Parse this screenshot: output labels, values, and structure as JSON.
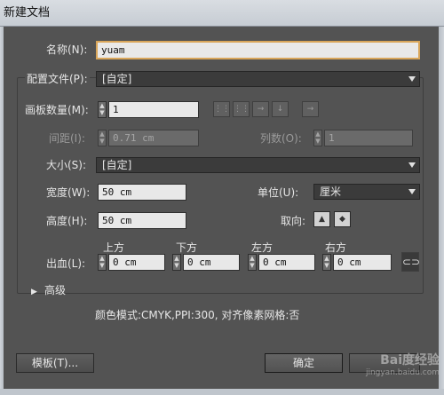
{
  "window": {
    "title": "新建文档"
  },
  "name": {
    "label": "名称(N):",
    "value": "yuam"
  },
  "profile": {
    "label": "配置文件(P):",
    "value": "[自定]"
  },
  "artboards": {
    "count_label": "画板数量(M):",
    "count_value": "1",
    "layout_icons": [
      "grid-by-row-icon",
      "grid-by-column-icon",
      "arrange-by-row-icon",
      "arrange-by-column-icon",
      "right-to-left-icon"
    ],
    "spacing_label": "间距(I):",
    "spacing_value": "0.71 cm",
    "columns_label": "列数(O):",
    "columns_value": "1"
  },
  "size": {
    "label": "大小(S):",
    "value": "[自定]"
  },
  "width": {
    "label": "宽度(W):",
    "value": "50 cm"
  },
  "units": {
    "label": "单位(U):",
    "value": "厘米"
  },
  "height": {
    "label": "高度(H):",
    "value": "50 cm"
  },
  "orientation": {
    "label": "取向:",
    "icons": [
      "portrait-icon",
      "landscape-icon"
    ]
  },
  "bleed": {
    "label": "出血(L):",
    "top_label": "上方",
    "top_value": "0 cm",
    "bottom_label": "下方",
    "bottom_value": "0 cm",
    "left_label": "左方",
    "left_value": "0 cm",
    "right_label": "右方",
    "right_value": "0 cm",
    "link_icon": "chain-link-icon"
  },
  "advanced": {
    "label": "高级"
  },
  "summary": "颜色模式:CMYK,PPI:300, 对齐像素网格:否",
  "buttons": {
    "templates": "模板(T)...",
    "ok": "确定"
  },
  "watermark": {
    "text": "Bai度经验",
    "url": "jingyan.baidu.com"
  }
}
